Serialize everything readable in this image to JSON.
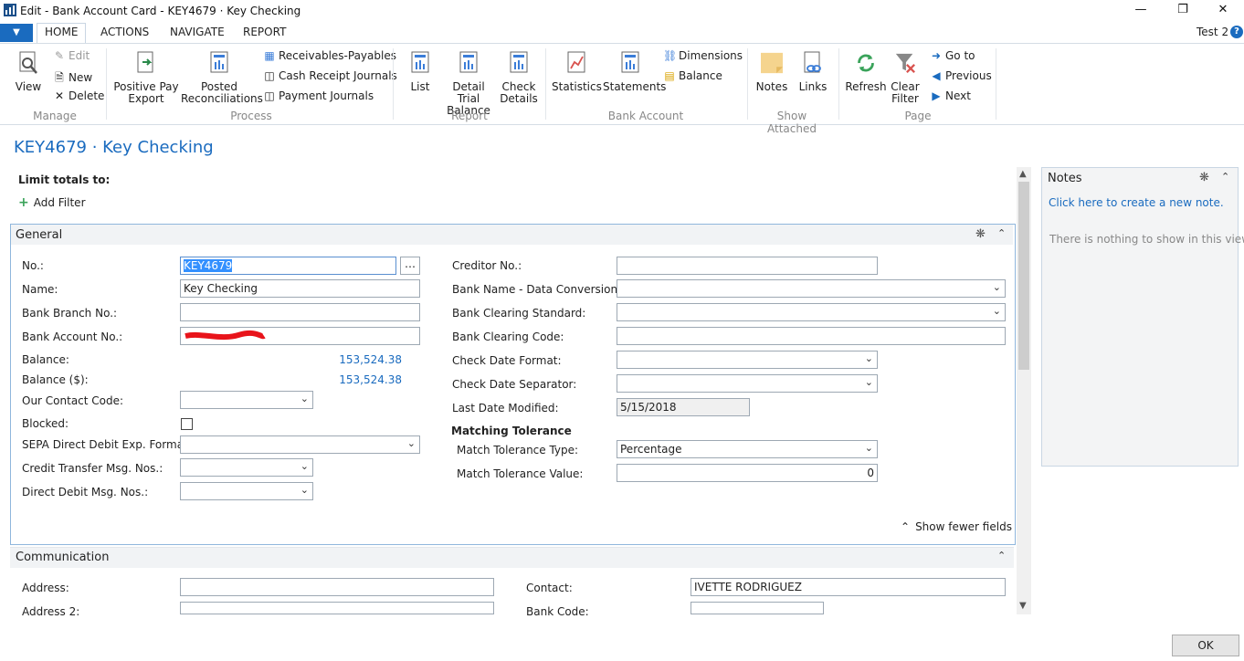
{
  "window": {
    "title": "Edit - Bank Account Card - KEY4679 · Key Checking",
    "user": "Test 2"
  },
  "tabs": [
    "HOME",
    "ACTIONS",
    "NAVIGATE",
    "REPORT"
  ],
  "ribbon": {
    "manage": {
      "label": "Manage",
      "view": "View",
      "edit": "Edit",
      "new": "New",
      "delete": "Delete"
    },
    "process": {
      "label": "Process",
      "positive_pay": [
        "Positive Pay",
        "Export"
      ],
      "posted": [
        "Posted",
        "Reconciliations"
      ],
      "receivables": "Receivables-Payables",
      "cash_receipt": "Cash Receipt Journals",
      "payment": "Payment Journals"
    },
    "report": {
      "label": "Report",
      "list": "List",
      "detail": [
        "Detail Trial",
        "Balance"
      ],
      "check": [
        "Check",
        "Details"
      ]
    },
    "bank_account": {
      "label": "Bank Account",
      "statistics": "Statistics",
      "statements": "Statements",
      "dimensions": "Dimensions",
      "balance": "Balance"
    },
    "show_attached": {
      "label": "Show Attached",
      "notes": "Notes",
      "links": "Links"
    },
    "page": {
      "label": "Page",
      "refresh": "Refresh",
      "clear_filter": [
        "Clear",
        "Filter"
      ],
      "goto": "Go to",
      "previous": "Previous",
      "next": "Next"
    }
  },
  "page_title": "KEY4679 · Key Checking",
  "limit_totals": "Limit totals to:",
  "add_filter": "Add Filter",
  "general": {
    "title": "General",
    "left": {
      "no_label": "No.:",
      "no_value": "KEY4679",
      "name_label": "Name:",
      "name_value": "Key Checking",
      "branch_label": "Bank Branch No.:",
      "account_label": "Bank Account No.:",
      "balance_label": "Balance:",
      "balance_value": "153,524.38",
      "balance_usd_label": "Balance ($):",
      "balance_usd_value": "153,524.38",
      "contact_label": "Our Contact Code:",
      "blocked_label": "Blocked:",
      "sepa_label": "SEPA Direct Debit Exp. Format:",
      "credit_label": "Credit Transfer Msg. Nos.:",
      "direct_label": "Direct Debit Msg. Nos.:"
    },
    "right": {
      "creditor_label": "Creditor No.:",
      "bank_name_label": "Bank Name - Data Conversion:",
      "clearing_std_label": "Bank Clearing Standard:",
      "clearing_code_label": "Bank Clearing Code:",
      "check_format_label": "Check Date Format:",
      "check_sep_label": "Check Date Separator:",
      "last_modified_label": "Last Date Modified:",
      "last_modified_value": "5/15/2018",
      "matching_heading": "Matching Tolerance",
      "tol_type_label": "Match Tolerance Type:",
      "tol_type_value": "Percentage",
      "tol_value_label": "Match Tolerance Value:",
      "tol_value_value": "0"
    },
    "show_fewer": "Show fewer fields"
  },
  "communication": {
    "title": "Communication",
    "address_label": "Address:",
    "address2_label": "Address 2:",
    "contact_label": "Contact:",
    "contact_value": "IVETTE RODRIGUEZ",
    "bank_code_label": "Bank Code:"
  },
  "notes": {
    "title": "Notes",
    "create": "Click here to create a new note.",
    "empty": "There is nothing to show in this view."
  },
  "ok": "OK",
  "colors": {
    "accent": "#1a6bbf",
    "section_border": "#8fb6dc"
  }
}
